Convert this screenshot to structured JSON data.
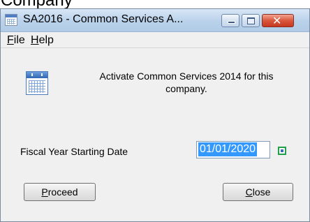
{
  "window": {
    "title": "SA2016 - Common Services A...",
    "caption_buttons": {
      "minimize": "minimize",
      "maximize": "maximize",
      "close": "✕"
    }
  },
  "menubar": {
    "items": [
      {
        "label": "File",
        "mnemonic": "F",
        "rest": "ile"
      },
      {
        "label": "Help",
        "mnemonic": "H",
        "rest": "elp"
      }
    ]
  },
  "content": {
    "message": "Activate Common Services 2014  for this company.",
    "fiscal_label": "Fiscal Year Starting Date",
    "fiscal_date": "01/01/2020"
  },
  "buttons": {
    "proceed": {
      "mnemonic": "P",
      "rest": "roceed"
    },
    "close": {
      "mnemonic": "C",
      "rest": "lose"
    }
  },
  "icons": {
    "app": "calendar-app-icon",
    "content": "calendar-icon",
    "picker": "date-picker-icon"
  },
  "colors": {
    "selection": "#3399ff",
    "close_button": "#c7391f",
    "titlebar": "#b9d1ea",
    "picker_border": "#1fa14a"
  }
}
